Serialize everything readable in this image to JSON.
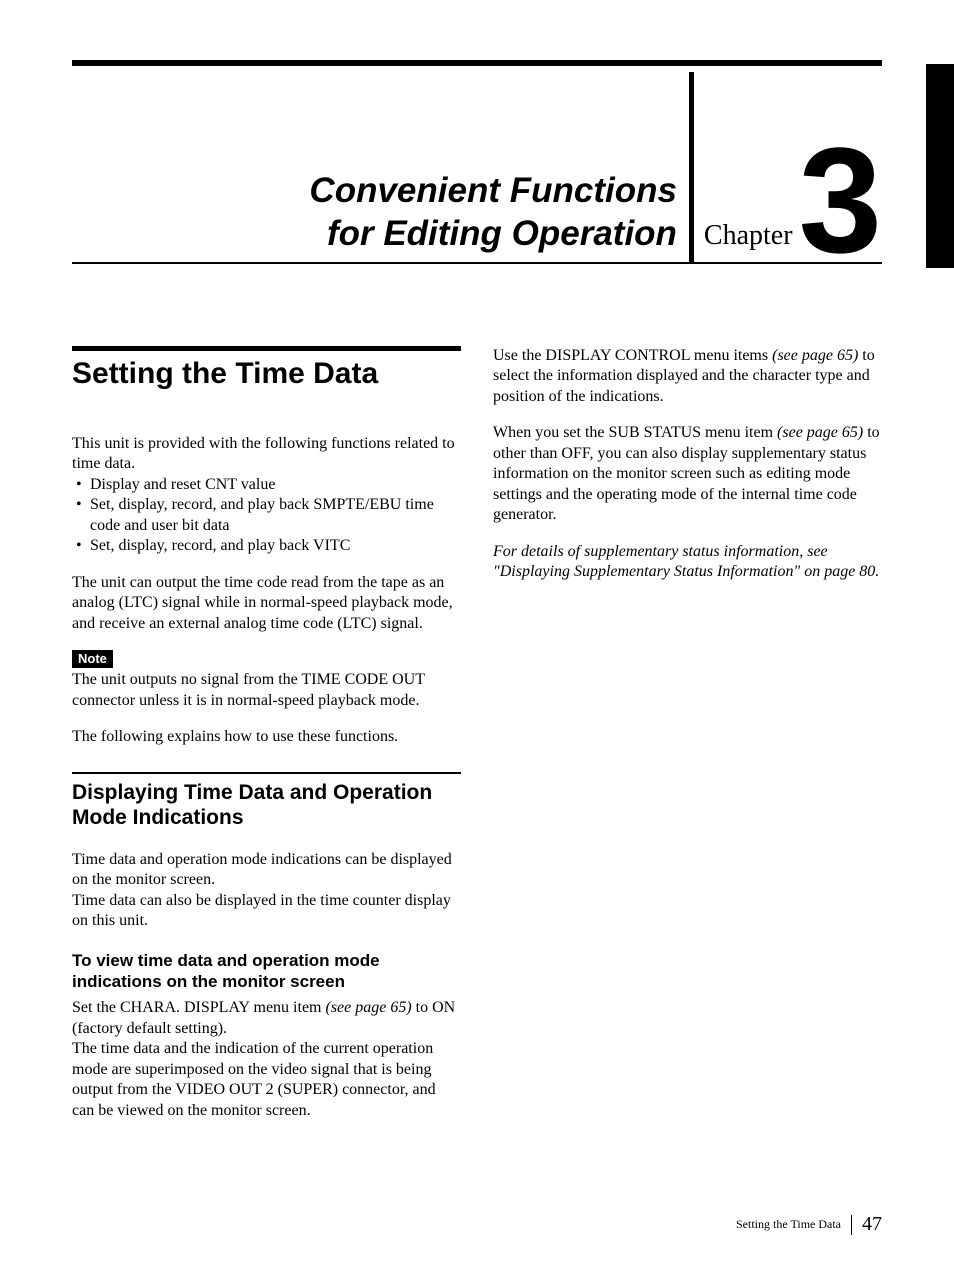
{
  "chapter": {
    "title_line1": "Convenient Functions",
    "title_line2": "for Editing Operation",
    "label": "Chapter",
    "number": "3"
  },
  "section": {
    "title": "Setting the Time Data",
    "intro": "This unit is provided with the following functions related to time data.",
    "bullets": [
      "Display and reset CNT value",
      "Set, display, record, and play back SMPTE/EBU time code and user bit data",
      "Set, display, record, and play back VITC"
    ],
    "para_after_bullets": "The unit can output the time code read from the tape as an analog (LTC) signal while in normal-speed playback mode, and receive an external analog time code (LTC) signal.",
    "note_label": "Note",
    "note_body": "The unit outputs no signal from the TIME CODE OUT connector unless it is in normal-speed playback mode.",
    "following": "The following explains how to use these functions."
  },
  "subsection": {
    "title": "Displaying Time Data and Operation Mode Indications",
    "para1": "Time data and operation mode indications can be displayed on the monitor screen.",
    "para2": "Time data can also be displayed in the time counter display on this unit.",
    "subsub_title": "To view time data and operation mode indications on the monitor screen",
    "sub_para1_a": "Set the CHARA. DISPLAY menu item ",
    "sub_para1_ref": "(see page 65)",
    "sub_para1_b": " to ON (factory default setting).",
    "sub_para2": "The time data and the indication of the current operation mode are superimposed on the video signal that is being output from the VIDEO OUT 2 (SUPER) connector, and can be viewed on the monitor screen."
  },
  "col2": {
    "para1_a": "Use the DISPLAY CONTROL menu items ",
    "para1_ref": "(see page 65)",
    "para1_b": " to select the information displayed and the character type and position of the indications.",
    "para2_a": "When you set the SUB STATUS menu item ",
    "para2_ref": "(see page 65)",
    "para2_b": " to other than OFF, you can also display supplementary status information on the monitor screen such as editing mode settings and the operating mode of the internal time code generator.",
    "italic": "For details of supplementary status information, see \"Displaying Supplementary Status Information\" on page 80."
  },
  "footer": {
    "running": "Setting the Time Data",
    "page": "47"
  }
}
